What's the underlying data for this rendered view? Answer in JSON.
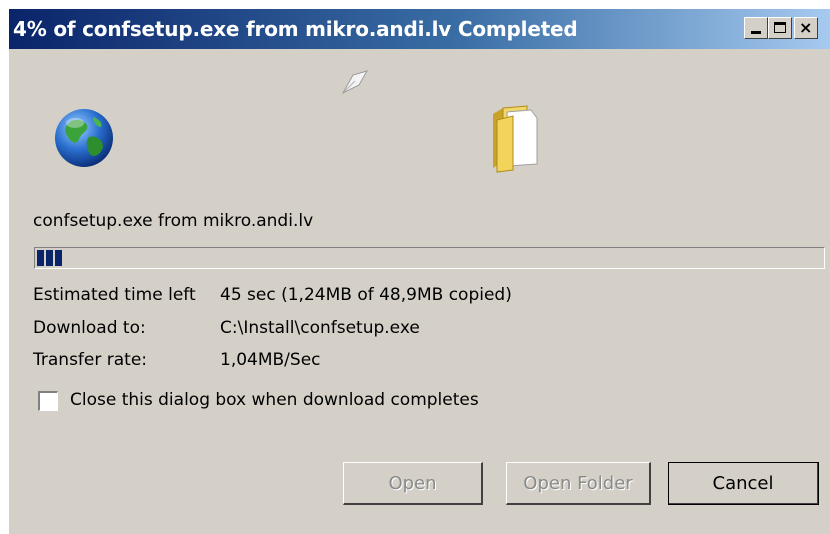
{
  "window": {
    "title": "4% of confsetup.exe from mikro.andi.lv Completed",
    "controls": {
      "minimize": "_",
      "maximize": "□",
      "close": "×"
    }
  },
  "icons": {
    "source": "globe-icon",
    "transfer": "paper-icon",
    "destination": "folder-icon"
  },
  "download": {
    "file_label": "confsetup.exe from mikro.andi.lv",
    "progress_fraction": 0.04,
    "rows": [
      {
        "label": "Estimated time left",
        "value": "45 sec (1,24MB of 48,9MB copied)"
      },
      {
        "label": "Download to:",
        "value": "C:\\Install\\confsetup.exe"
      },
      {
        "label": "Transfer rate:",
        "value": "1,04MB/Sec"
      }
    ]
  },
  "options": {
    "close_when_done_label": "Close this dialog box when download completes",
    "close_when_done_checked": false
  },
  "buttons": {
    "open": "Open",
    "open_folder": "Open Folder",
    "cancel": "Cancel"
  },
  "colors": {
    "titlebar_start": "#0a246a",
    "titlebar_end": "#a6caf0",
    "dialog_bg": "#d4d0c8",
    "progress_block": "#0a246a"
  }
}
